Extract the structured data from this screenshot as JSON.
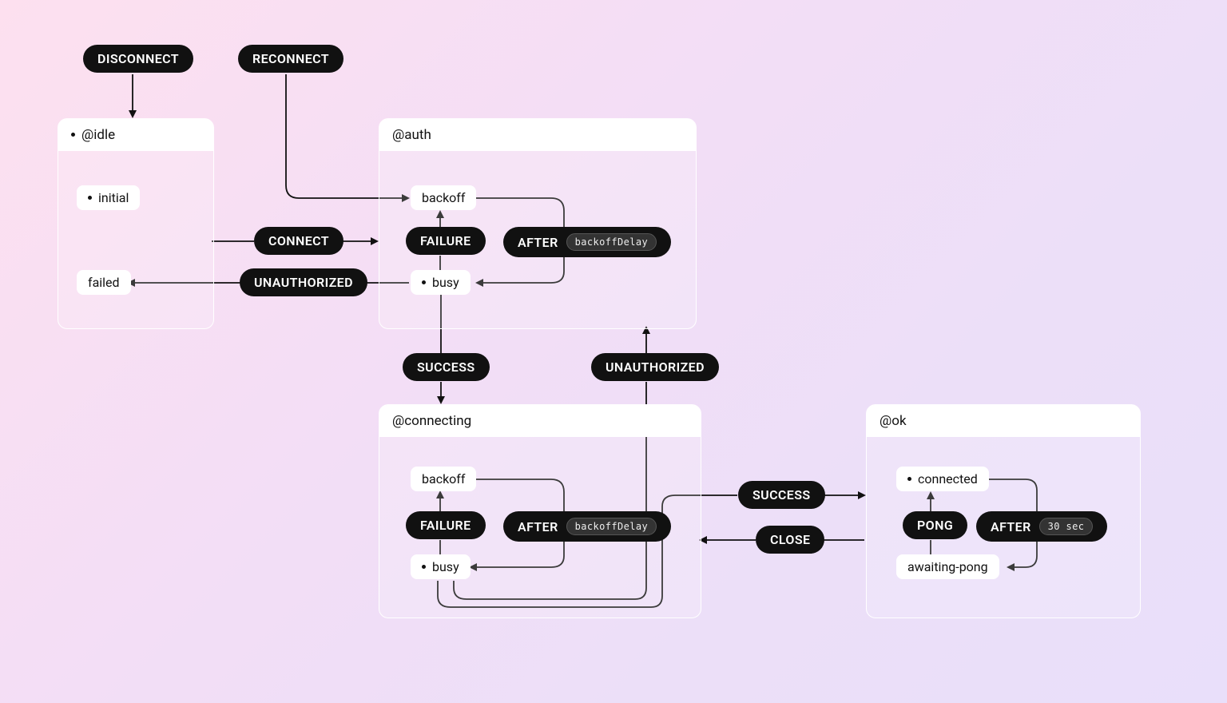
{
  "diagram": {
    "type": "state-machine",
    "regions": {
      "idle": {
        "title": "@idle",
        "initial": true,
        "states": {
          "initial": {
            "label": "initial",
            "initial": true
          },
          "failed": {
            "label": "failed"
          }
        }
      },
      "auth": {
        "title": "@auth",
        "states": {
          "backoff": {
            "label": "backoff"
          },
          "busy": {
            "label": "busy",
            "initial": true
          }
        }
      },
      "connecting": {
        "title": "@connecting",
        "states": {
          "backoff": {
            "label": "backoff"
          },
          "busy": {
            "label": "busy",
            "initial": true
          }
        }
      },
      "ok": {
        "title": "@ok",
        "states": {
          "connected": {
            "label": "connected",
            "initial": true
          },
          "awaiting_pong": {
            "label": "awaiting-pong"
          }
        }
      }
    },
    "events": {
      "disconnect": {
        "label": "DISCONNECT"
      },
      "reconnect": {
        "label": "RECONNECT"
      },
      "connect": {
        "label": "CONNECT"
      },
      "auth_failure": {
        "label": "FAILURE"
      },
      "auth_after": {
        "label": "AFTER",
        "sub": "backoffDelay"
      },
      "auth_unauthorized": {
        "label": "UNAUTHORIZED"
      },
      "auth_success": {
        "label": "SUCCESS"
      },
      "conn_failure": {
        "label": "FAILURE"
      },
      "conn_after": {
        "label": "AFTER",
        "sub": "backoffDelay"
      },
      "conn_unauthorized": {
        "label": "UNAUTHORIZED"
      },
      "conn_success": {
        "label": "SUCCESS"
      },
      "conn_close": {
        "label": "CLOSE"
      },
      "ok_pong": {
        "label": "PONG"
      },
      "ok_after": {
        "label": "AFTER",
        "sub": "30 sec"
      }
    },
    "transitions": [
      {
        "from": null,
        "event": "disconnect",
        "to": "idle"
      },
      {
        "from": null,
        "event": "reconnect",
        "to": "auth.backoff"
      },
      {
        "from": "idle",
        "event": "connect",
        "to": "auth"
      },
      {
        "from": "auth.busy",
        "event": "auth_failure",
        "to": "auth.backoff"
      },
      {
        "from": "auth.backoff",
        "event": "auth_after",
        "to": "auth.busy"
      },
      {
        "from": "auth.busy",
        "event": "auth_unauthorized",
        "to": "idle.failed"
      },
      {
        "from": "auth.busy",
        "event": "auth_success",
        "to": "connecting"
      },
      {
        "from": "connecting.busy",
        "event": "conn_failure",
        "to": "connecting.backoff"
      },
      {
        "from": "connecting.backoff",
        "event": "conn_after",
        "to": "connecting.busy"
      },
      {
        "from": "connecting.busy",
        "event": "conn_unauthorized",
        "to": "auth"
      },
      {
        "from": "connecting.busy",
        "event": "conn_success",
        "to": "ok"
      },
      {
        "from": "ok.connected",
        "event": "ok_after",
        "to": "ok.awaiting_pong"
      },
      {
        "from": "ok.awaiting_pong",
        "event": "ok_pong",
        "to": "ok.connected"
      },
      {
        "from": "ok",
        "event": "conn_close",
        "to": "connecting"
      }
    ]
  }
}
